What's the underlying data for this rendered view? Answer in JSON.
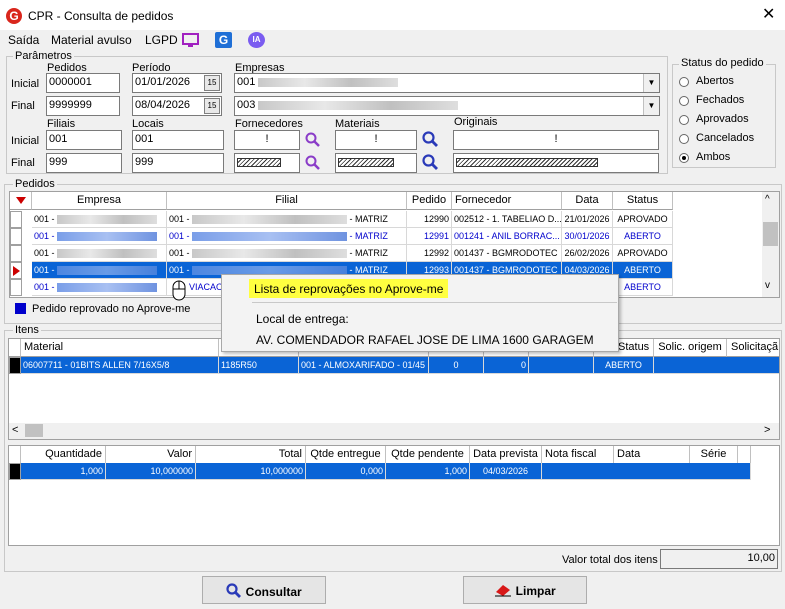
{
  "window": {
    "title": "CPR - Consulta de pedidos",
    "logo_letter": "G",
    "close": "✕"
  },
  "menu": {
    "items": [
      "Saída",
      "Material avulso",
      "LGPD"
    ],
    "icon_ia": "IA",
    "icon_g": "G"
  },
  "params": {
    "group": "Parâmetros",
    "pedidos": "Pedidos",
    "periodo": "Período",
    "empresas": "Empresas",
    "inicial": "Inicial",
    "final": "Final",
    "pedido_ini": "0000001",
    "pedido_fim": "9999999",
    "data_ini": "01/01/2026",
    "data_fim": "08/04/2026",
    "cal_btn": "15",
    "empresa_ini": "001",
    "empresa_fim": "003",
    "filiais": "Filiais",
    "locais": "Locais",
    "fornecedores": "Fornecedores",
    "materiais": "Materiais",
    "originais": "Originais",
    "filial_ini": "001",
    "filial_fim": "999",
    "local_ini": "001",
    "local_fim": "999",
    "fornecedor_ini": "!",
    "material_ini": "!",
    "original_ini": "!"
  },
  "status": {
    "group": "Status do pedido",
    "options": [
      "Abertos",
      "Fechados",
      "Aprovados",
      "Cancelados",
      "Ambos"
    ],
    "selected": "Ambos"
  },
  "pedidos": {
    "group": "Pedidos",
    "headers": [
      "Empresa",
      "Filial",
      "Pedido",
      "Fornecedor",
      "Data",
      "Status"
    ],
    "rows": [
      {
        "empresa": "001 -",
        "filial_pre": "001 -",
        "filial_suf": "- MATRIZ",
        "pedido": "12990",
        "fornecedor": "002512 - 1. TABELIAO D...",
        "data": "21/01/2026",
        "status": "APROVADO",
        "style": "black"
      },
      {
        "empresa": "001 -",
        "filial_pre": "001 -",
        "filial_suf": "- MATRIZ",
        "pedido": "12991",
        "fornecedor": "001241 - ANIL BORRAC...",
        "data": "30/01/2026",
        "status": "ABERTO",
        "style": "blue"
      },
      {
        "empresa": "001 -",
        "filial_pre": "001 -",
        "filial_suf": "- MATRIZ",
        "pedido": "12992",
        "fornecedor": "001437 - BGMRODOTEC",
        "data": "26/02/2026",
        "status": "APROVADO",
        "style": "black"
      },
      {
        "empresa": "001 -",
        "filial_pre": "001 -",
        "filial_suf": "- MATRIZ",
        "pedido": "12993",
        "fornecedor": "001437 - BGMRODOTEC",
        "data": "04/03/2026",
        "status": "ABERTO",
        "style": "selected"
      },
      {
        "empresa": "001 -",
        "filial_pre": "",
        "filial_suf": "VIACAO",
        "pedido": "",
        "fornecedor": "",
        "data": "",
        "status": "ABERTO",
        "style": "blue"
      }
    ],
    "legend": "Pedido reprovado no Aprove-me"
  },
  "itens": {
    "group": "Itens",
    "headers": [
      "Material",
      "",
      "",
      "",
      "",
      "",
      "Status",
      "Solic. origem",
      "Solicitaçã"
    ],
    "row": {
      "material": "06007711 - 01BITS ALLEN 7/16X5/8",
      "ref": "1185R50",
      "local": "001 - ALMOXARIFADO - 01/45",
      "q1": "0",
      "q2": "0",
      "status": "ABERTO"
    },
    "qheaders": [
      "Quantidade",
      "Valor",
      "Total",
      "Qtde entregue",
      "Qtde pendente",
      "Data prevista",
      "Nota fiscal",
      "Data",
      "Série"
    ],
    "qrow": {
      "quantidade": "1,000",
      "valor": "10,000000",
      "total": "10,000000",
      "entregue": "0,000",
      "pendente": "1,000",
      "prevista": "04/03/2026"
    },
    "total_label": "Valor total dos itens",
    "total_value": "10,00"
  },
  "tooltip": {
    "title": "Lista de reprovações no Aprove-me",
    "local_label": "Local de entrega:",
    "local_value": "AV. COMENDADOR RAFAEL JOSE DE LIMA 1600 GARAGEM"
  },
  "buttons": {
    "consultar": "Consultar",
    "limpar": "Limpar"
  },
  "colors": {
    "accent": "#0a64d6",
    "hyper": "#0000cc",
    "logo": "#d9261c",
    "tooltip_highlight": "#ffff40"
  }
}
